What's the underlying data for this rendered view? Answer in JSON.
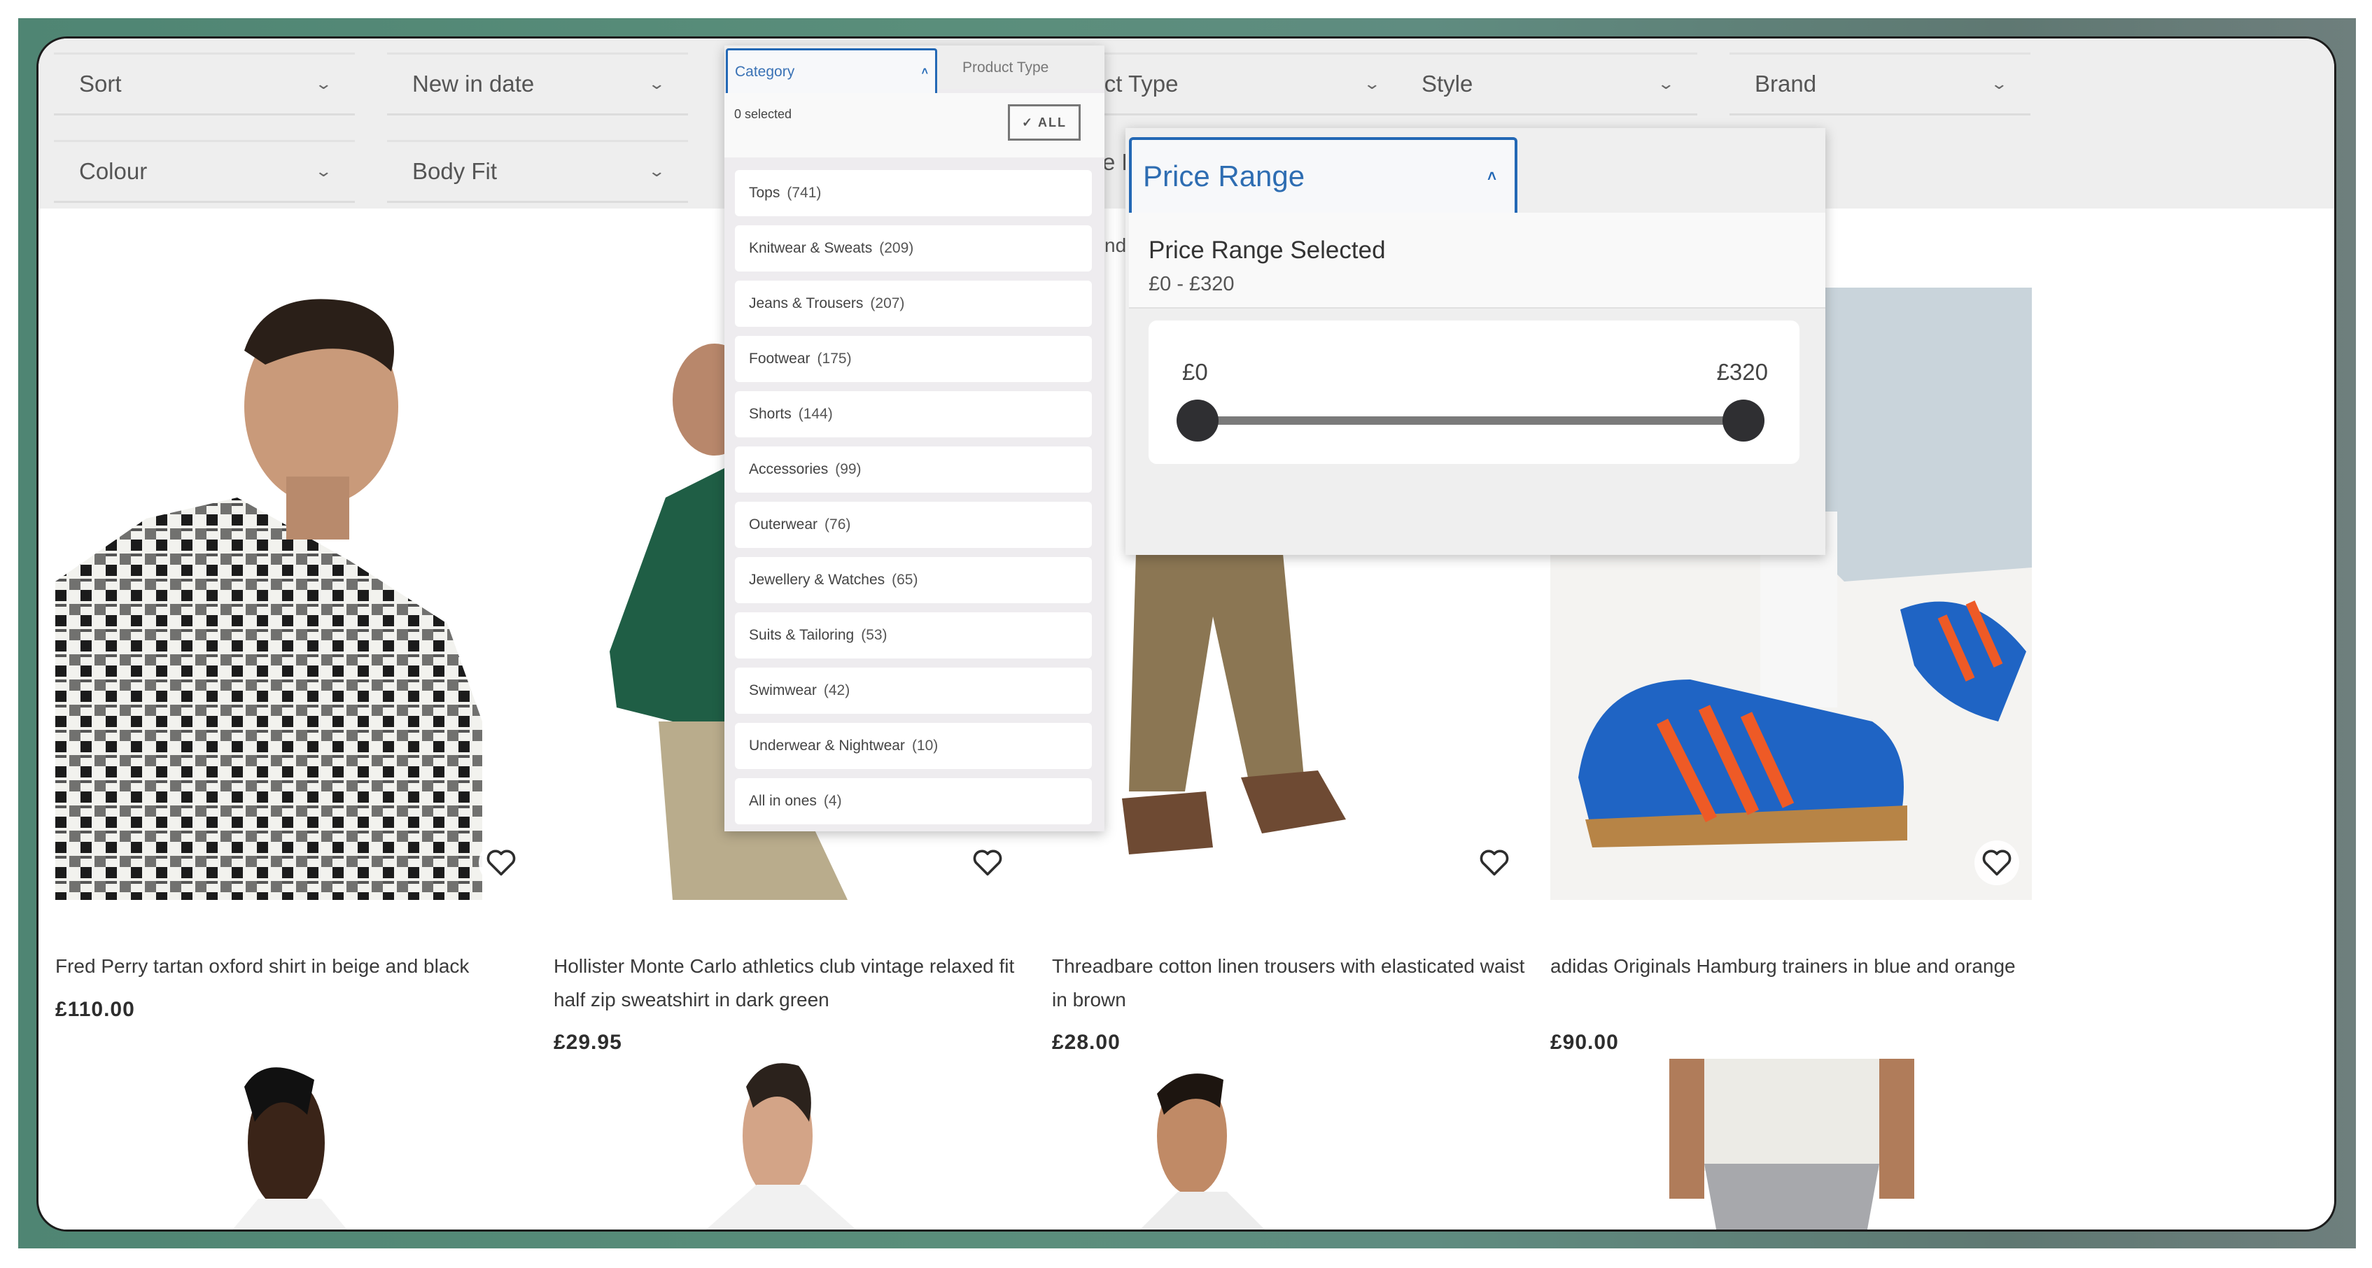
{
  "filters": {
    "row1": [
      {
        "label": "Sort"
      },
      {
        "label": "New in date"
      },
      {
        "label": "Category"
      },
      {
        "label": "Product Type"
      },
      {
        "label": "Style"
      },
      {
        "label": "Brand"
      }
    ],
    "row2": [
      {
        "label": "Colour"
      },
      {
        "label": "Body Fit"
      },
      {
        "label": "Price Range"
      }
    ],
    "peek_row1": "duct Type",
    "peek_row2": "e R",
    "peek_row3": "nd"
  },
  "category_dropdown": {
    "label": "Category",
    "next_tab": "Product Type",
    "selected_count": "0 selected",
    "select_all_label": "ALL",
    "items": [
      {
        "name": "Tops",
        "count": "(741)"
      },
      {
        "name": "Knitwear & Sweats",
        "count": "(209)"
      },
      {
        "name": "Jeans & Trousers",
        "count": "(207)"
      },
      {
        "name": "Footwear",
        "count": "(175)"
      },
      {
        "name": "Shorts",
        "count": "(144)"
      },
      {
        "name": "Accessories",
        "count": "(99)"
      },
      {
        "name": "Outerwear",
        "count": "(76)"
      },
      {
        "name": "Jewellery & Watches",
        "count": "(65)"
      },
      {
        "name": "Suits & Tailoring",
        "count": "(53)"
      },
      {
        "name": "Swimwear",
        "count": "(42)"
      },
      {
        "name": "Underwear & Nightwear",
        "count": "(10)"
      },
      {
        "name": "All in ones",
        "count": "(4)"
      }
    ]
  },
  "price_range": {
    "label": "Price Range",
    "selected_title": "Price Range Selected",
    "selected_value": "£0 - £320",
    "min_label": "£0",
    "max_label": "£320",
    "min": 0,
    "max": 320,
    "low": 0,
    "high": 320
  },
  "products": [
    {
      "title": "Fred Perry tartan oxford shirt in beige and black",
      "price": "£110.00"
    },
    {
      "title": "Hollister Monte Carlo athletics club vintage relaxed fit half zip sweatshirt in dark green",
      "price": "£29.95"
    },
    {
      "title": "Threadbare cotton linen trousers with elasticated waist in brown",
      "price": "£28.00"
    },
    {
      "title": "adidas Originals Hamburg trainers in blue and orange",
      "price": "£90.00"
    }
  ],
  "colors": {
    "accent": "#2368b5",
    "filter_bg": "#eeeeee",
    "backdrop": "#4f8573"
  }
}
